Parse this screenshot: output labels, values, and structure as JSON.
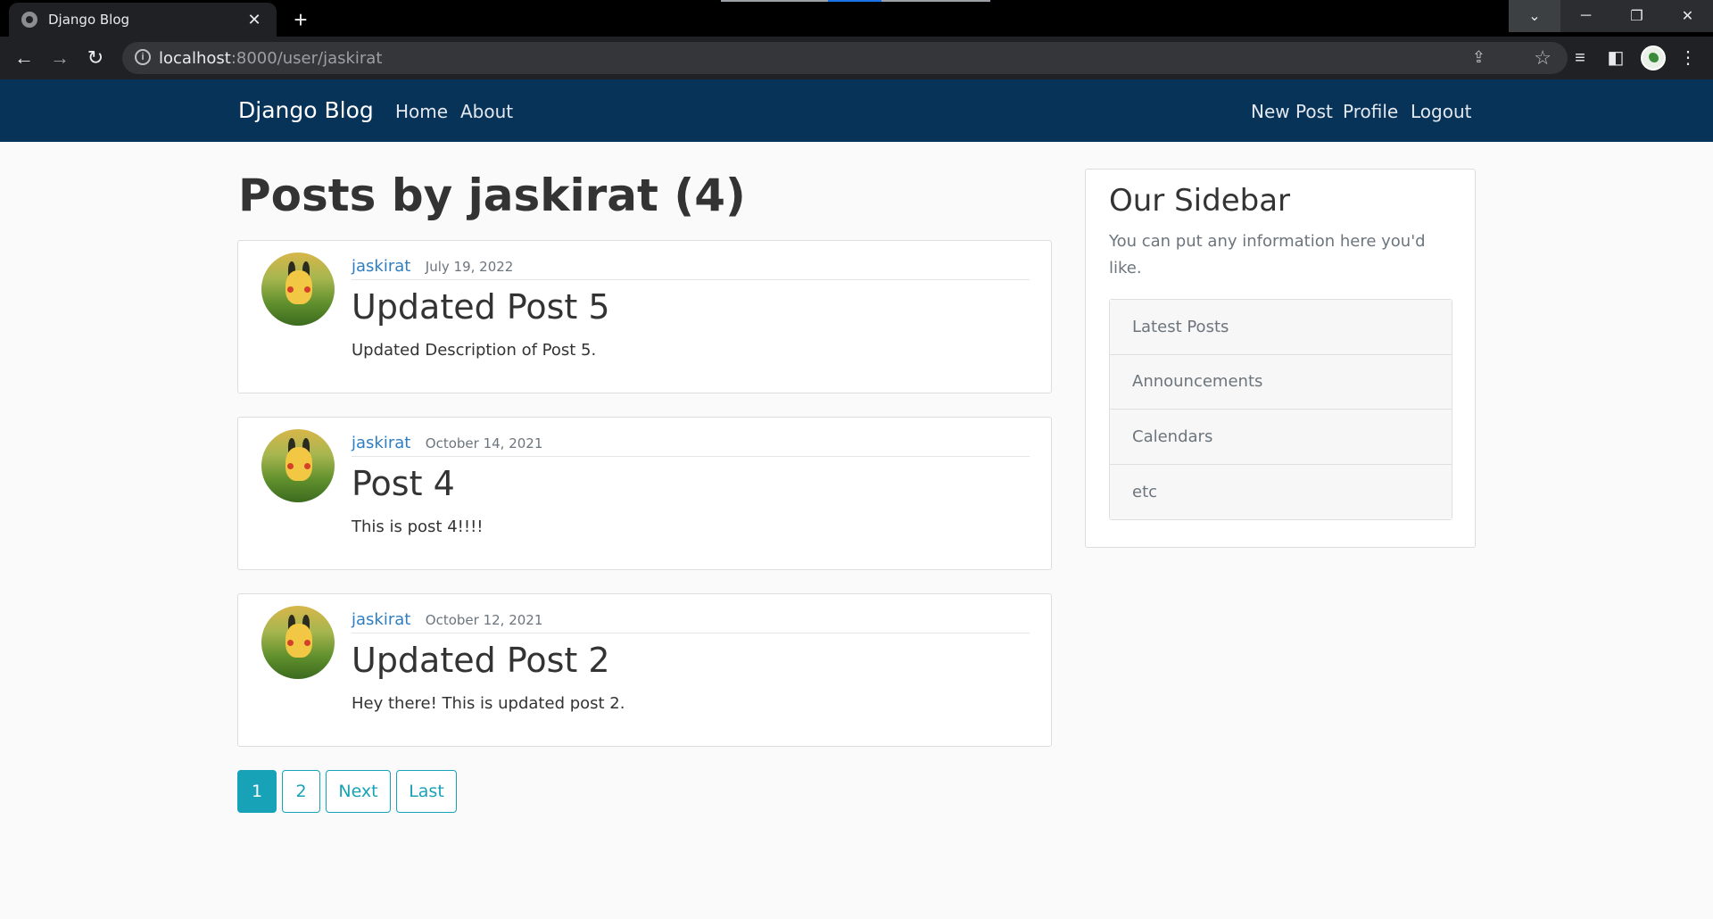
{
  "browser": {
    "tab_title": "Django Blog",
    "url_host": "localhost",
    "url_path": ":8000/user/jaskirat"
  },
  "navbar": {
    "brand": "Django Blog",
    "left_links": [
      "Home",
      "About"
    ],
    "right_links": [
      "New Post",
      "Profile",
      "Logout"
    ],
    "bg_color": "#083359"
  },
  "main": {
    "title": "Posts by jaskirat (4)",
    "posts": [
      {
        "author": "jaskirat",
        "date": "July 19, 2022",
        "title": "Updated Post 5",
        "content": "Updated Description of Post 5."
      },
      {
        "author": "jaskirat",
        "date": "October 14, 2021",
        "title": "Post 4",
        "content": "This is post 4!!!!"
      },
      {
        "author": "jaskirat",
        "date": "October 12, 2021",
        "title": "Updated Post 2",
        "content": "Hey there! This is updated post 2."
      }
    ],
    "pagination": {
      "current": "1",
      "pages": [
        "1",
        "2"
      ],
      "next": "Next",
      "last": "Last",
      "accent": "#17a2b8"
    }
  },
  "sidebar": {
    "title": "Our Sidebar",
    "subtitle": "You can put any information here you'd like.",
    "items": [
      "Latest Posts",
      "Announcements",
      "Calendars",
      "etc"
    ]
  }
}
